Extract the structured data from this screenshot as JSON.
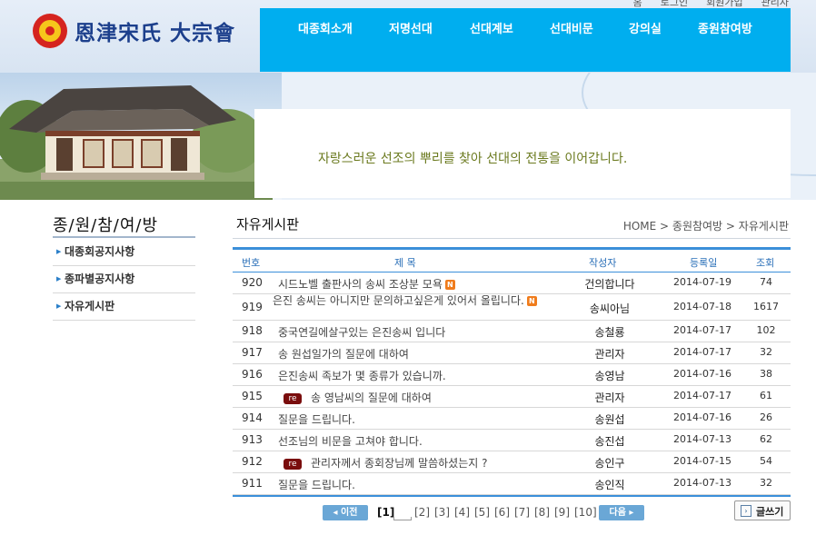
{
  "top_links": [
    "홈",
    "로그인",
    "회원가입",
    "관리자"
  ],
  "logo": {
    "text": "恩津宋氏 大宗會"
  },
  "nav": [
    "대종회소개",
    "저명선대",
    "선대계보",
    "선대비문",
    "강의실",
    "종원참여방"
  ],
  "tagline": "자랑스러운 선조의 뿌리를 찾아 선대의 전통을 이어갑니다.",
  "sidebar": {
    "title": "종/원/참/여/방",
    "items": [
      "대종회공지사항",
      "종파별공지사항",
      "자유게시판"
    ]
  },
  "page_title": "자유게시판",
  "breadcrumb": "HOME > 종원참여방 > 자유게시판",
  "table": {
    "headers": {
      "num": "번호",
      "subject": "제 목",
      "author": "작성자",
      "date": "등록일",
      "views": "조회"
    },
    "rows": [
      {
        "num": "920",
        "subject": "시드노벨 출판사의 송씨 조상분 모욕",
        "author": "건의합니다",
        "date": "2014-07-19",
        "views": "74",
        "new": "N"
      },
      {
        "num": "919",
        "subject": "은진 송씨는 아니지만 문의하고싶은게 있어서 올립니다.",
        "author": "송씨아님",
        "date": "2014-07-18",
        "views": "1617",
        "new": "N"
      },
      {
        "num": "918",
        "subject": "중국연길에살구있는 은진송씨 입니다",
        "author": "송철룡",
        "date": "2014-07-17",
        "views": "102"
      },
      {
        "num": "917",
        "subject": "송 원섭일가의 질문에 대하여",
        "author": "관리자",
        "date": "2014-07-17",
        "views": "32"
      },
      {
        "num": "916",
        "subject": "은진송씨 족보가 몇 종류가 있습니까.",
        "author": "송영남",
        "date": "2014-07-16",
        "views": "38"
      },
      {
        "num": "915",
        "subject": "송 영남씨의 질문에 대하여",
        "author": "관리자",
        "date": "2014-07-17",
        "views": "61",
        "re": "re"
      },
      {
        "num": "914",
        "subject": "질문을 드립니다.",
        "author": "송원섭",
        "date": "2014-07-16",
        "views": "26"
      },
      {
        "num": "913",
        "subject": "선조님의 비문을 고쳐야 합니다.",
        "author": "송진섭",
        "date": "2014-07-13",
        "views": "62"
      },
      {
        "num": "912",
        "subject": "관리자께서 종회장님께 말씀하셨는지 ?",
        "author": "송인구",
        "date": "2014-07-15",
        "views": "54",
        "re": "re"
      },
      {
        "num": "911",
        "subject": "질문을 드립니다.",
        "author": "송인직",
        "date": "2014-07-13",
        "views": "32"
      }
    ]
  },
  "pagination": {
    "prev": "이전",
    "next": "다음",
    "pages": [
      "[1]",
      "[2]",
      "[3]",
      "[4]",
      "[5]",
      "[6]",
      "[7]",
      "[8]",
      "[9]",
      "[10]"
    ]
  },
  "write_button": "글쓰기"
}
